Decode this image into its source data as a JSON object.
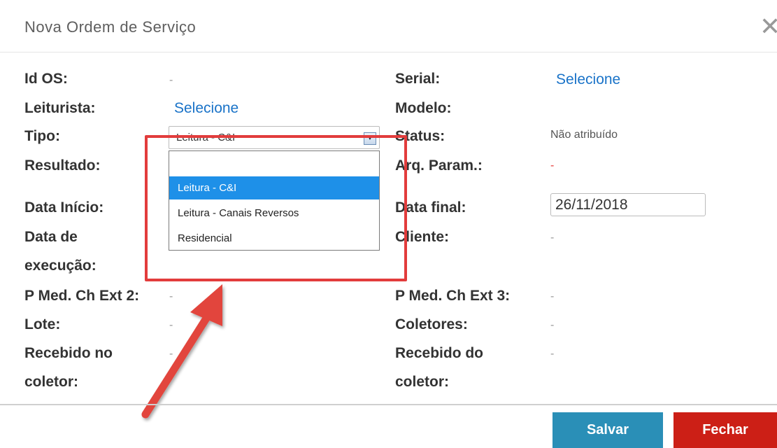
{
  "dialog": {
    "title": "Nova Ordem de Serviço",
    "close_glyph": "✕"
  },
  "left": {
    "id_os_label": "Id OS:",
    "id_os_value": "-",
    "leiturista_label": "Leiturista:",
    "leiturista_value": "Selecione",
    "tipo_label": "Tipo:",
    "tipo_value": "Leitura - C&I",
    "tipo_options": [
      "",
      "Leitura - C&I",
      "Leitura - Canais Reversos",
      "Residencial"
    ],
    "resultado_label": "Resultado:",
    "data_inicio_label": "Data Início:",
    "data_execucao_label_1": "Data de",
    "data_execucao_label_2": "execução:",
    "p_med_2_label": "P Med. Ch Ext 2:",
    "p_med_2_value": "-",
    "lote_label": "Lote:",
    "lote_value": "-",
    "recebido_no_label_1": "Recebido no",
    "recebido_no_label_2": "coletor:",
    "recebido_no_value": "-"
  },
  "right": {
    "serial_label": "Serial:",
    "serial_value": "Selecione",
    "modelo_label": "Modelo:",
    "status_label": "Status:",
    "status_value": "Não atribuído",
    "arq_param_label": "Arq. Param.:",
    "arq_param_value": "-",
    "data_final_label": "Data final:",
    "data_final_value": "26/11/2018",
    "cliente_label": "Cliente:",
    "cliente_value": "-",
    "p_med_3_label": "P Med. Ch Ext 3:",
    "p_med_3_value": "-",
    "coletores_label": "Coletores:",
    "coletores_value": "-",
    "recebido_do_label_1": "Recebido do",
    "recebido_do_label_2": "coletor:",
    "recebido_do_value": "-"
  },
  "footer": {
    "save_label": "Salvar",
    "close_label": "Fechar"
  },
  "colors": {
    "save": "#2a8fb7",
    "close": "#cc1f16",
    "link": "#1a73c8",
    "selected_option": "#1e90e8",
    "annotation": "#e23c3c"
  }
}
